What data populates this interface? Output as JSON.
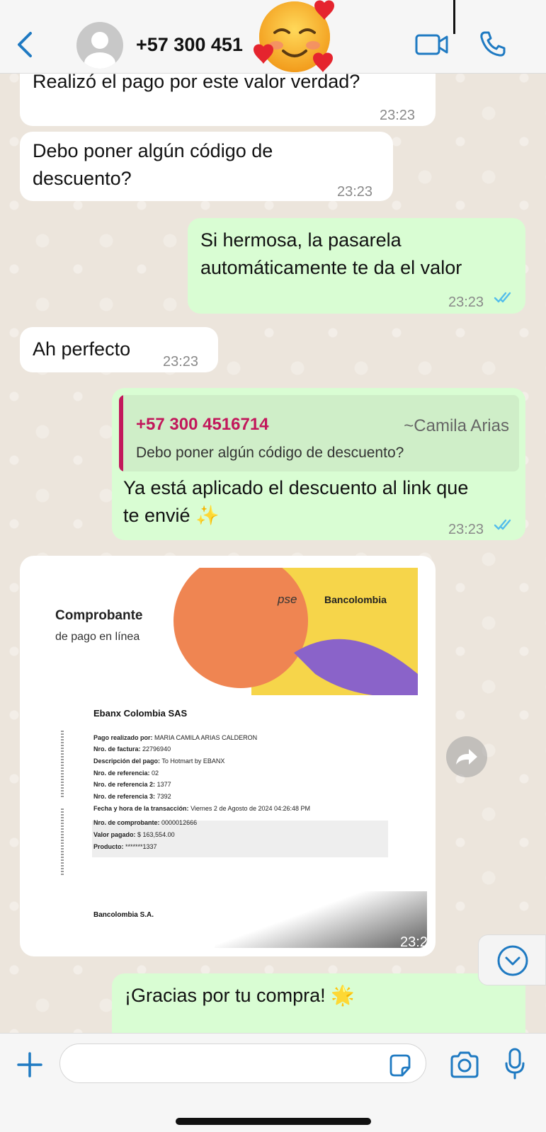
{
  "header": {
    "contact": "+57 300 451",
    "status_emoji": "🥰"
  },
  "messages": [
    {
      "id": "m1",
      "dir": "in",
      "text": "Realizó el pago por este valor verdad?",
      "time": "23:23"
    },
    {
      "id": "m2",
      "dir": "in",
      "text": "Debo poner algún código de\ndescuento?",
      "time": "23:23"
    },
    {
      "id": "m3",
      "dir": "out",
      "text": "Si hermosa, la pasarela\nautomáticamente te da el valor",
      "time": "23:23",
      "read": true
    },
    {
      "id": "m4",
      "dir": "in",
      "text": "Ah perfecto",
      "time": "23:23"
    },
    {
      "id": "m5",
      "dir": "out",
      "quote_sender": "+57 300 4516714",
      "quote_alias": "~Camila Arias",
      "quote_text": "Debo poner algún código de descuento?",
      "text": "Ya está aplicado el descuento al link que\nte envié ✨",
      "time": "23:23",
      "read": true
    },
    {
      "id": "m7",
      "dir": "out",
      "text": "¡Gracias por tu compra! 🌟"
    }
  ],
  "receipt": {
    "title": "Comprobante",
    "subtitle": "de pago en línea",
    "brand_pse": "pse",
    "brand_bank": "Bancolombia",
    "company": "Ebanx Colombia SAS",
    "fields": [
      {
        "label": "Pago realizado por:",
        "value": "MARIA CAMILA ARIAS CALDERON"
      },
      {
        "label": "Nro. de factura:",
        "value": "22796940"
      },
      {
        "label": "Descripción del pago:",
        "value": "To Hotmart by EBANX"
      },
      {
        "label": "Nro. de referencia:",
        "value": "02"
      },
      {
        "label": "Nro. de referencia 2:",
        "value": "1377"
      },
      {
        "label": "Nro. de referencia 3:",
        "value": "7392"
      },
      {
        "label": "Fecha y hora de la transacción:",
        "value": "Viernes 2 de Agosto de 2024 04:26:48 PM"
      }
    ],
    "box_fields": [
      {
        "label": "Nro. de comprobante:",
        "value": "0000012666"
      },
      {
        "label": "Valor pagado:",
        "value": "$ 163,554.00"
      },
      {
        "label": "Producto:",
        "value": "*******1337"
      }
    ],
    "footer": "Bancolombia S.A.",
    "time": "23:27"
  },
  "colors": {
    "outgoing": "#d9fdd3",
    "incoming": "#ffffff",
    "accent": "#1f7ac2",
    "quote_sender": "#c2185b",
    "read_ticks": "#53bdeb"
  }
}
